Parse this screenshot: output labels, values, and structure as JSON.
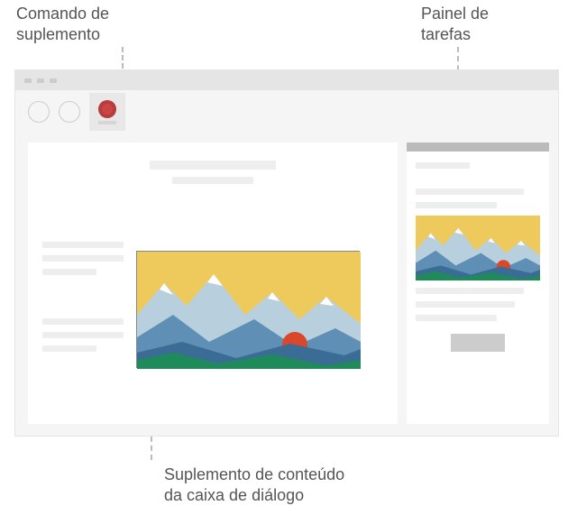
{
  "labels": {
    "addin_command": "Comando de\nsuplemento",
    "task_pane": "Painel de\ntarefas",
    "content_dialog": "Suplemento de conteúdo\nda caixa de diálogo"
  },
  "illustration": {
    "addin_command_button": {
      "color": "#c44444"
    },
    "content_addin_image": "mountain-scene",
    "task_pane_image": "mountain-scene"
  }
}
